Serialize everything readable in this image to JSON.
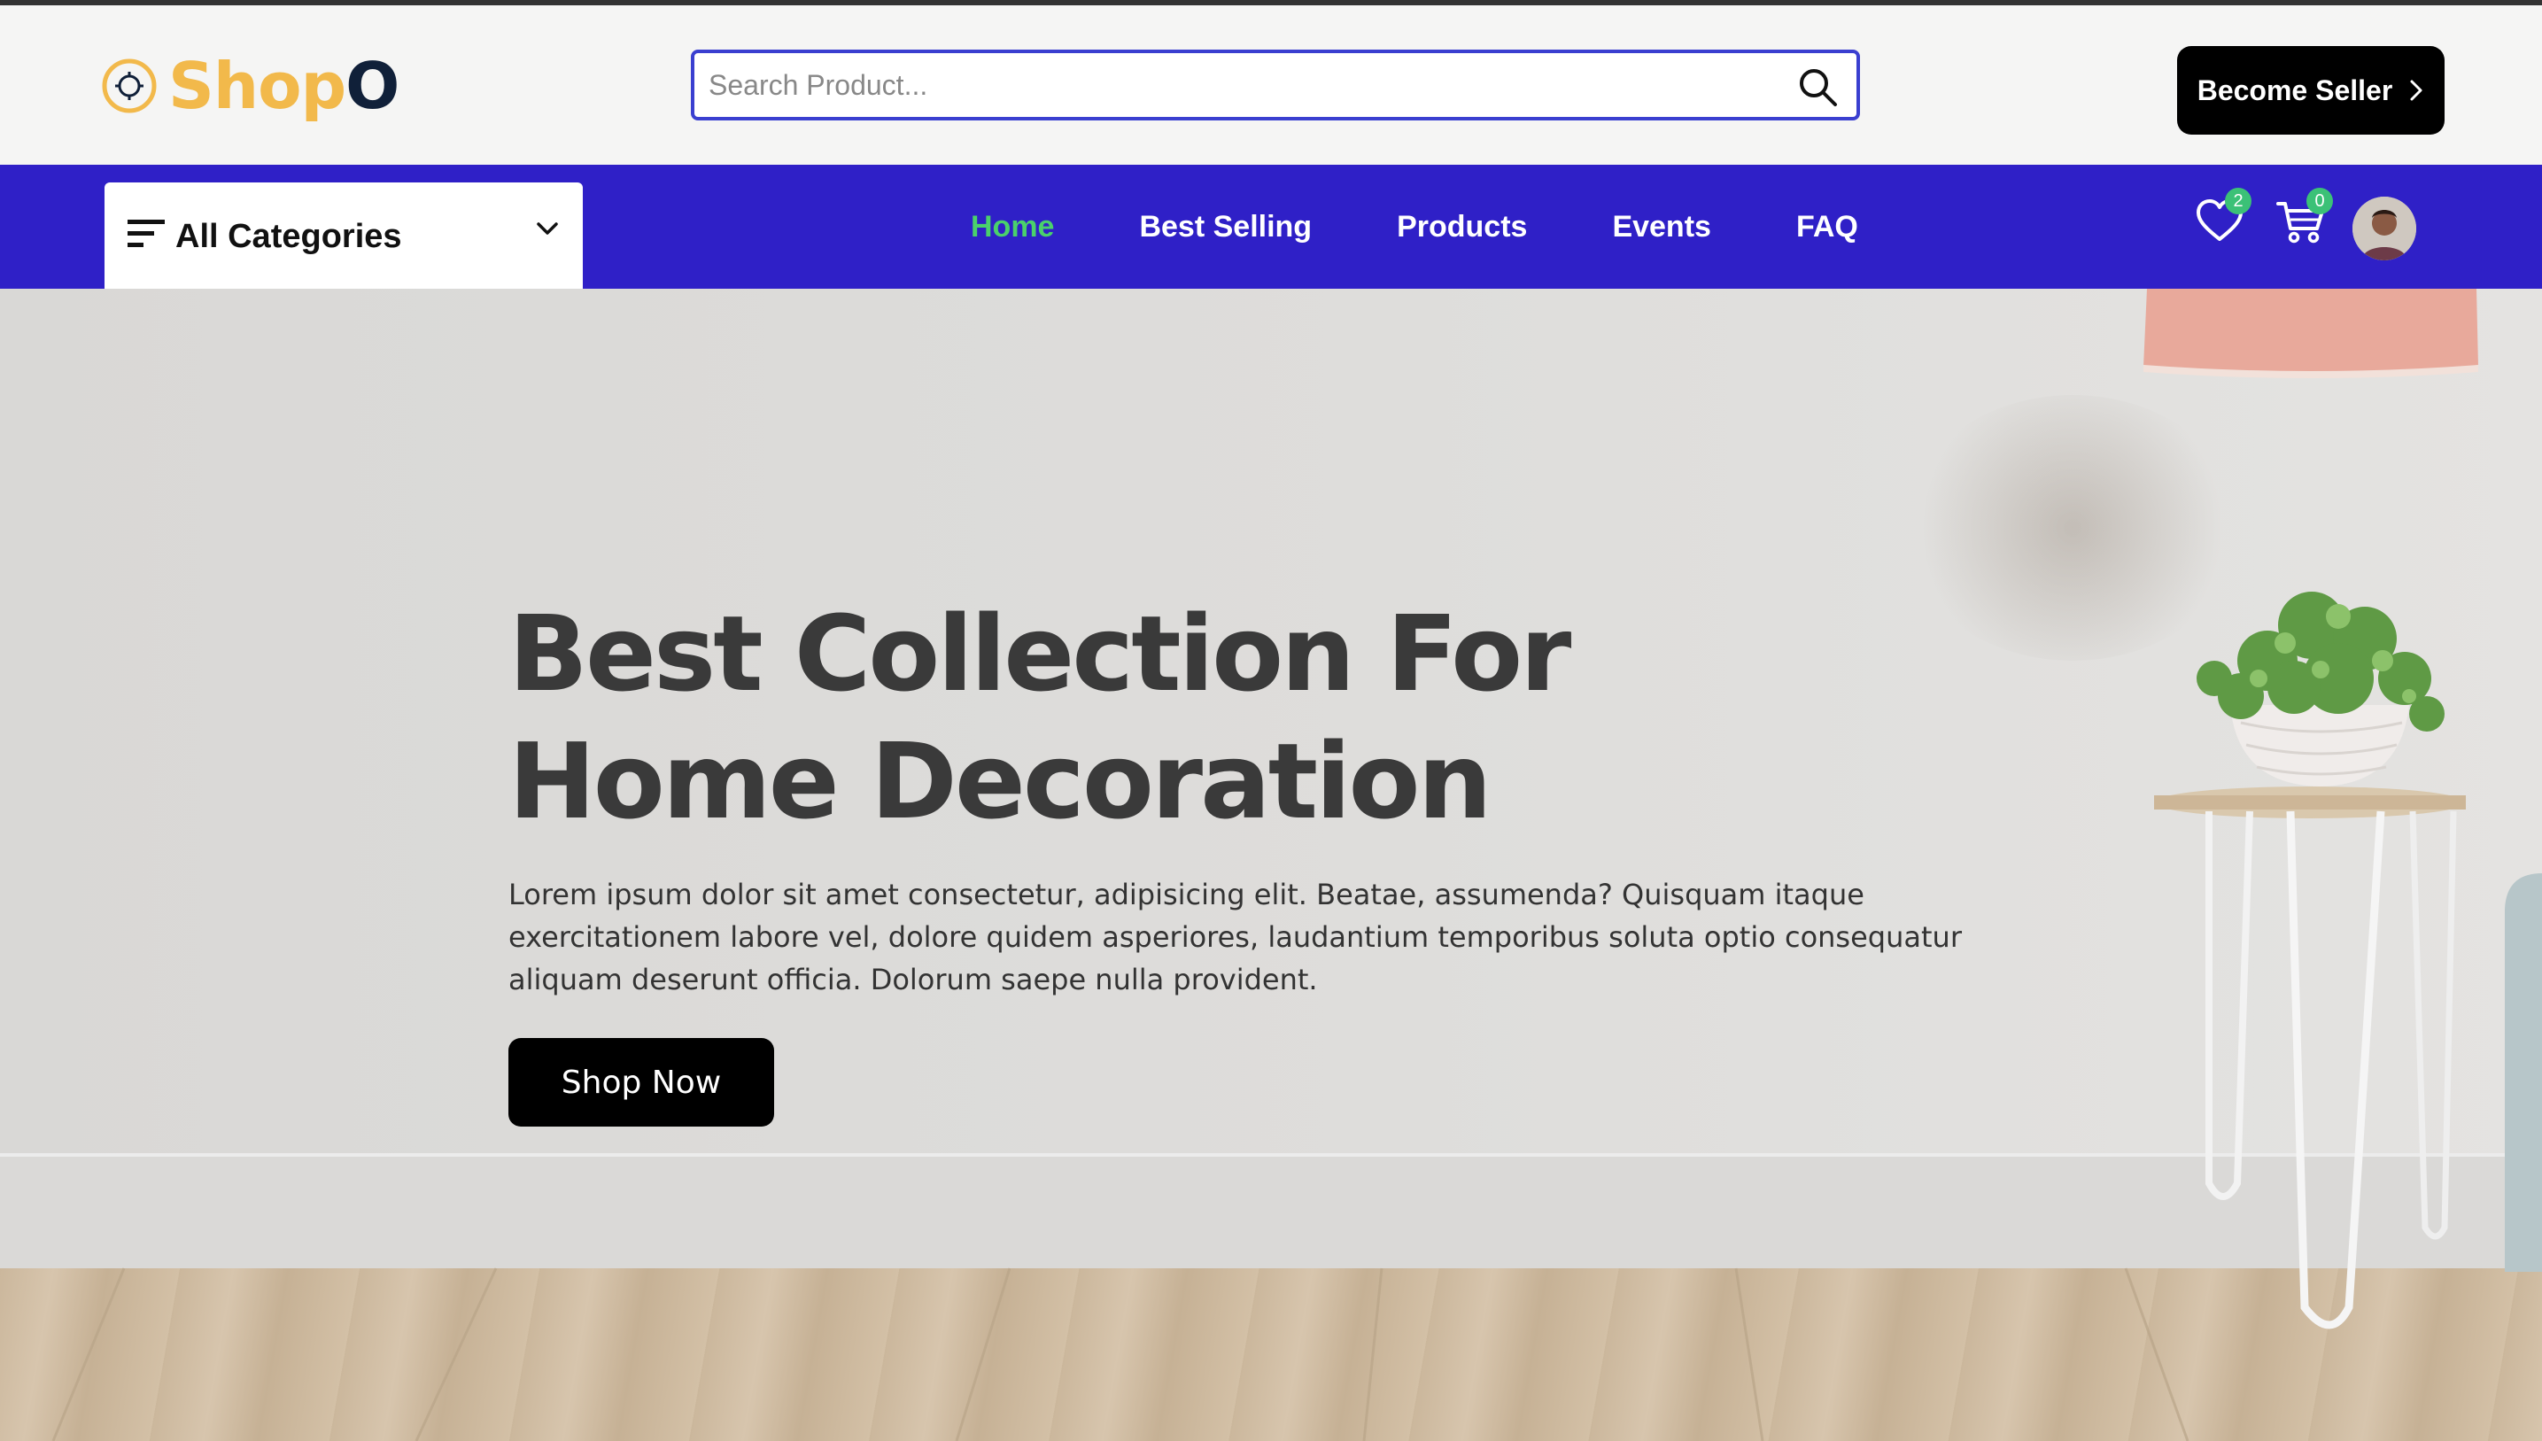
{
  "header": {
    "logo": {
      "text_main": "Shop",
      "text_accent": "O",
      "icon": "target-icon"
    },
    "search": {
      "placeholder": "Search Product...",
      "value": "",
      "icon": "search-icon"
    },
    "become_seller": {
      "label": "Become Seller",
      "icon": "chevron-right-icon"
    }
  },
  "navbar": {
    "categories": {
      "label": "All Categories",
      "icon": "menu-icon",
      "toggle_icon": "chevron-down-icon"
    },
    "links": [
      {
        "label": "Home",
        "active": true
      },
      {
        "label": "Best Selling",
        "active": false
      },
      {
        "label": "Products",
        "active": false
      },
      {
        "label": "Events",
        "active": false
      },
      {
        "label": "FAQ",
        "active": false
      }
    ],
    "wishlist": {
      "icon": "heart-icon",
      "count": "2"
    },
    "cart": {
      "icon": "cart-icon",
      "count": "0"
    },
    "profile": {
      "icon": "avatar"
    }
  },
  "hero": {
    "title_line1": "Best Collection For",
    "title_line2": "Home Decoration",
    "description": "Lorem ipsum dolor sit amet consectetur, adipisicing elit. Beatae, assumenda? Quisquam itaque exercitationem labore vel, dolore quidem asperiores, laudantium temporibus soluta optio consequatur aliquam deserunt officia. Dolorum saepe nulla provident.",
    "cta_label": "Shop Now"
  },
  "colors": {
    "brand_blue": "#2f20c7",
    "accent_green": "#4ad16b",
    "logo_yellow": "#f2b94b",
    "logo_navy": "#102039",
    "badge_green": "#3bc177"
  }
}
